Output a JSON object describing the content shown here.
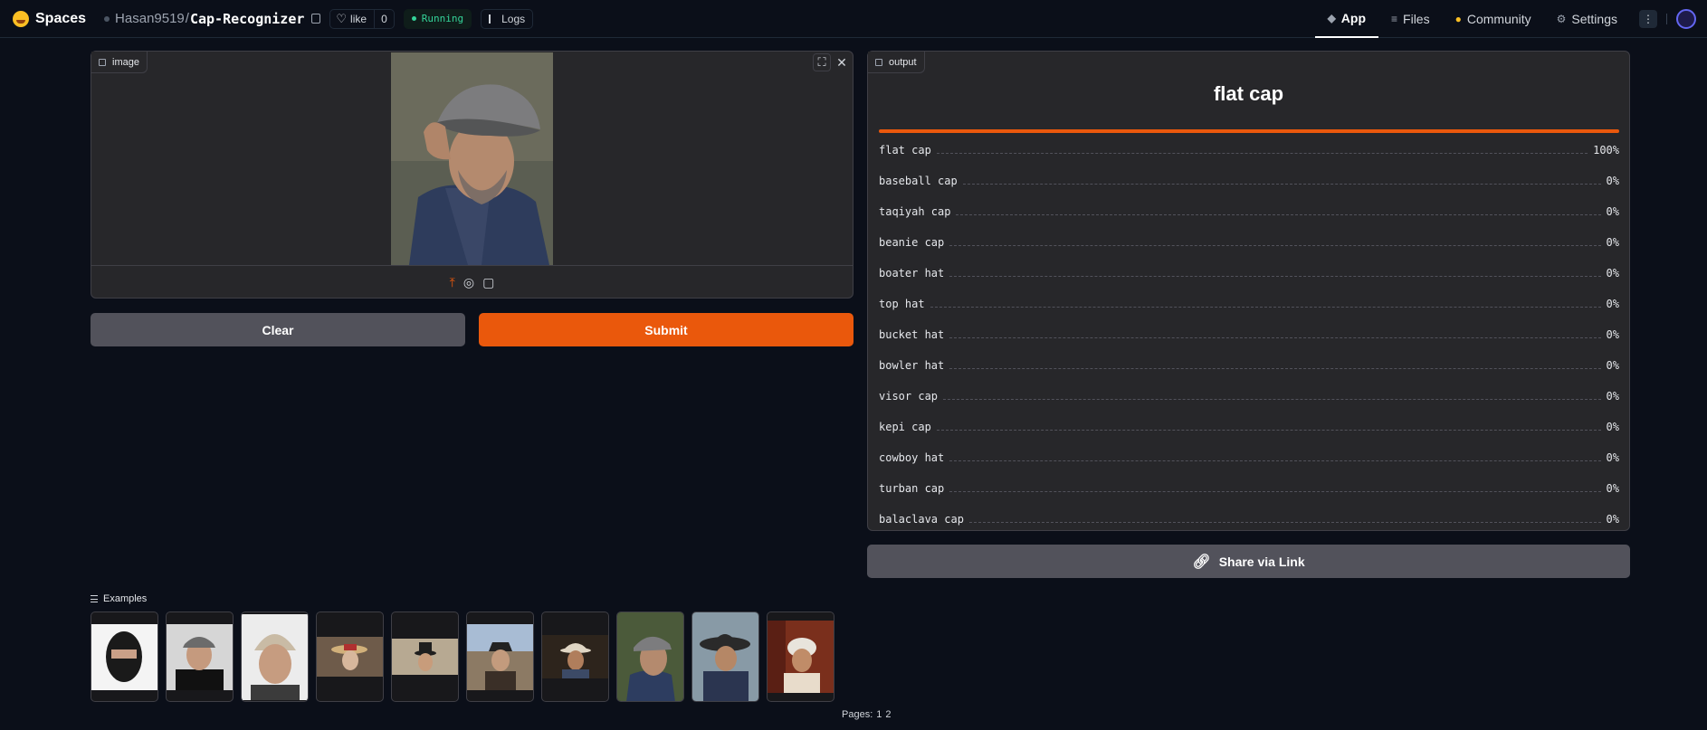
{
  "header": {
    "brand": "Spaces",
    "owner": "Hasan9519",
    "repo": "Cap-Recognizer",
    "like_label": "like",
    "like_count": "0",
    "status": "Running",
    "logs_label": "Logs",
    "nav": [
      {
        "label": "App",
        "icon": "cube-icon"
      },
      {
        "label": "Files",
        "icon": "files-icon"
      },
      {
        "label": "Community",
        "icon": "community-icon"
      },
      {
        "label": "Settings",
        "icon": "gear-icon"
      }
    ]
  },
  "input": {
    "tag": "image"
  },
  "buttons": {
    "clear": "Clear",
    "submit": "Submit",
    "share": "Share via Link"
  },
  "output": {
    "tag": "output",
    "title": "flat cap",
    "top_confidence": 1.0,
    "confidences": [
      {
        "label": "flat cap",
        "value": "100%"
      },
      {
        "label": "baseball cap",
        "value": "0%"
      },
      {
        "label": "taqiyah cap",
        "value": "0%"
      },
      {
        "label": "beanie cap",
        "value": "0%"
      },
      {
        "label": "boater hat",
        "value": "0%"
      },
      {
        "label": "top hat",
        "value": "0%"
      },
      {
        "label": "bucket hat",
        "value": "0%"
      },
      {
        "label": "bowler hat",
        "value": "0%"
      },
      {
        "label": "visor cap",
        "value": "0%"
      },
      {
        "label": "kepi cap",
        "value": "0%"
      },
      {
        "label": "cowboy hat",
        "value": "0%"
      },
      {
        "label": "turban cap",
        "value": "0%"
      },
      {
        "label": "balaclava cap",
        "value": "0%"
      }
    ]
  },
  "examples": {
    "label": "Examples",
    "pages_label": "Pages:",
    "pages": [
      "1",
      "2"
    ]
  },
  "colors": {
    "accent": "#ea580c",
    "running": "#34d399",
    "panel": "#27272a",
    "background": "#0b0f19"
  }
}
